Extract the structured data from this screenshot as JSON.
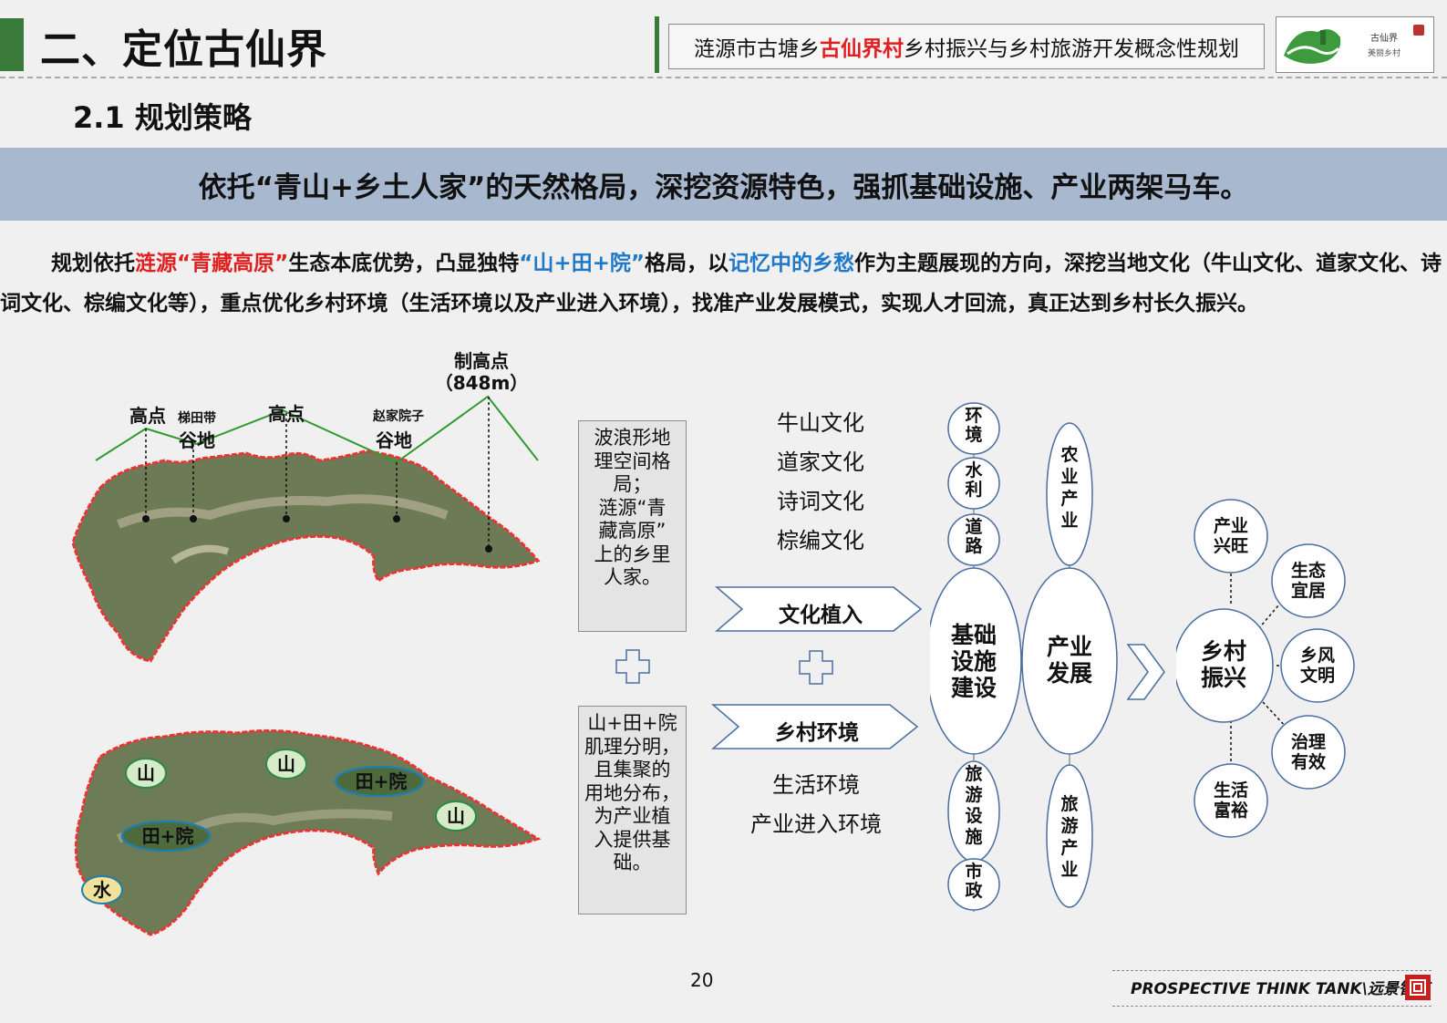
{
  "header": {
    "section_title": "二、定位古仙界",
    "project_pre": "涟源市古塘乡",
    "project_highlight": "古仙界村",
    "project_post": "乡村振兴与乡村旅游开发概念性规划",
    "logo_line1": "古仙界",
    "logo_line2": "美丽乡村"
  },
  "subtitle": "2.1  规划策略",
  "banner": "依托“青山+乡土人家”的天然格局，深挖资源特色，强抓基础设施、产业两架马车。",
  "intro": {
    "p1": "规划依托",
    "p2": "涟源“青藏高原”",
    "p3": "生态本底优势，凸显独特",
    "p4": "“山+田+院”",
    "p5": "格局，以",
    "p6": "记忆中的乡愁",
    "p7": "作为主题展现的方向，深挖当地文化（牛山文化、道家文化、诗词文化、棕编文化等），重点优化乡村环境（生活环境以及产业进入环境），找准产业发展模式，实现人才回流，真正达到乡村长久振兴。"
  },
  "terrain": {
    "labels": [
      "高点",
      "梯田带",
      "谷地",
      "高点",
      "赵家院子",
      "谷地",
      "制高点",
      "（848m）"
    ]
  },
  "map2": {
    "tags": [
      "山",
      "山",
      "田+院",
      "山",
      "田+院",
      "水"
    ]
  },
  "box1": [
    "波浪形地",
    "理空间格",
    "局；",
    "涟源“青",
    "藏高原”",
    "上的乡里",
    "人家。"
  ],
  "box2": [
    "山+田+院",
    "肌理分明，",
    "且集聚的",
    "用地分布，",
    "为产业植",
    "入提供基",
    "础。"
  ],
  "culture_list": [
    "牛山文化",
    "道家文化",
    "诗词文化",
    "棕编文化"
  ],
  "chevron1": "文化植入",
  "chevron2": "乡村环境",
  "env_list": [
    "生活环境",
    "产业进入环境"
  ],
  "infra": {
    "center": [
      "基础",
      "设施",
      "建设"
    ],
    "top": [
      [
        "环",
        "境"
      ],
      [
        "水",
        "利"
      ],
      [
        "道",
        "路"
      ]
    ],
    "bottom": [
      [
        "旅",
        "游",
        "设",
        "施"
      ],
      [
        "市",
        "政"
      ]
    ]
  },
  "industry": {
    "center": [
      "产业",
      "发展"
    ],
    "top": [
      "农",
      "业",
      "产",
      "业"
    ],
    "bottom": [
      "旅",
      "游",
      "产",
      "业"
    ]
  },
  "revitalize": {
    "center": [
      "乡村",
      "振兴"
    ],
    "items": [
      [
        "产业",
        "兴旺"
      ],
      [
        "生态",
        "宜居"
      ],
      [
        "乡风",
        "文明"
      ],
      [
        "治理",
        "有效"
      ],
      [
        "生活",
        "富裕"
      ]
    ]
  },
  "page_number": "20",
  "footer": "PROSPECTIVE THINK TANK\\远景智库"
}
